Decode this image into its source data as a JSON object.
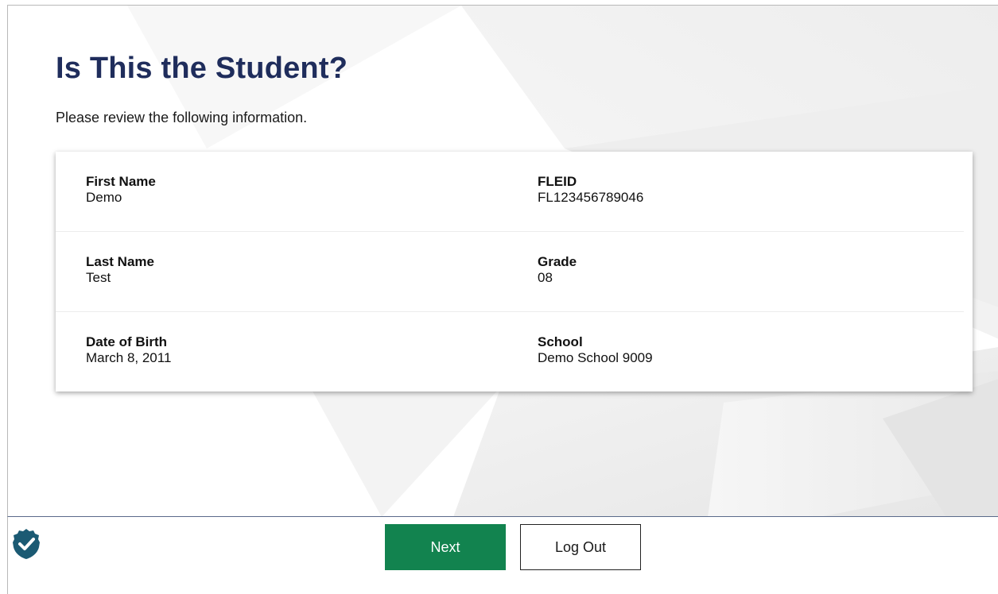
{
  "page": {
    "title": "Is This the Student?",
    "subtitle": "Please review the following information."
  },
  "student": {
    "rows": [
      {
        "left": {
          "label": "First Name",
          "value": "Demo"
        },
        "right": {
          "label": "FLEID",
          "value": "FL123456789046"
        }
      },
      {
        "left": {
          "label": "Last Name",
          "value": "Test"
        },
        "right": {
          "label": "Grade",
          "value": "08"
        }
      },
      {
        "left": {
          "label": "Date of Birth",
          "value": "March 8, 2011"
        },
        "right": {
          "label": "School",
          "value": "Demo School 9009"
        }
      }
    ]
  },
  "footer": {
    "next_label": "Next",
    "logout_label": "Log Out",
    "badge_icon": "shield-check-icon"
  },
  "colors": {
    "title": "#1f2d5c",
    "primary_button": "#12834f",
    "badge": "#1b5a73"
  }
}
